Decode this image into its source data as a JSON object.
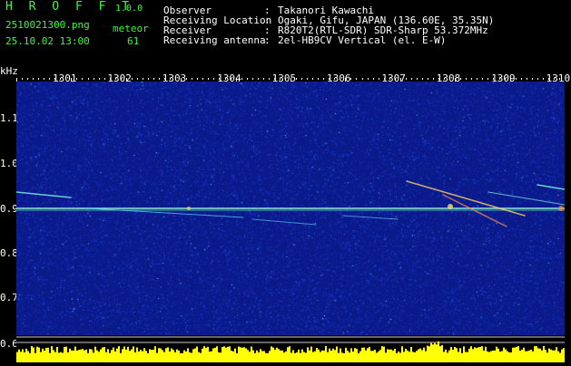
{
  "header": {
    "app_name": "H R O F F T",
    "version": "1.0.0",
    "filename": "2510021300.png",
    "detection_label": "meteor",
    "timestamp": "25.10.02 13:00",
    "detection_count": "61",
    "fields": [
      {
        "label": "Observer",
        "sep": ":",
        "value": "Takanori Kawachi"
      },
      {
        "label": "Receiving Location",
        "sep": ":",
        "value": "Ogaki, Gifu, JAPAN (136.60E, 35.35N)"
      },
      {
        "label": "Receiver",
        "sep": ":",
        "value": "R820T2(RTL-SDR) SDR-Sharp 53.372MHz"
      },
      {
        "label": "Receiving antenna",
        "sep": ":",
        "value": "2el-HB9CV Vertical (el. E-W)"
      }
    ]
  },
  "axis": {
    "unit": "kHz",
    "x_ticks": [
      "1301",
      "1302",
      "1303",
      "1304",
      "1305",
      "1306",
      "1307",
      "1308",
      "1309",
      "1310"
    ],
    "y_ticks": [
      "1.1",
      "1.0",
      "0.9",
      "0.8",
      "0.7",
      "0.6"
    ]
  },
  "colors": {
    "background": "#0a1a8a",
    "text": "#ffffff",
    "accent": "#33ff33",
    "spectrum": "#ffff00"
  }
}
